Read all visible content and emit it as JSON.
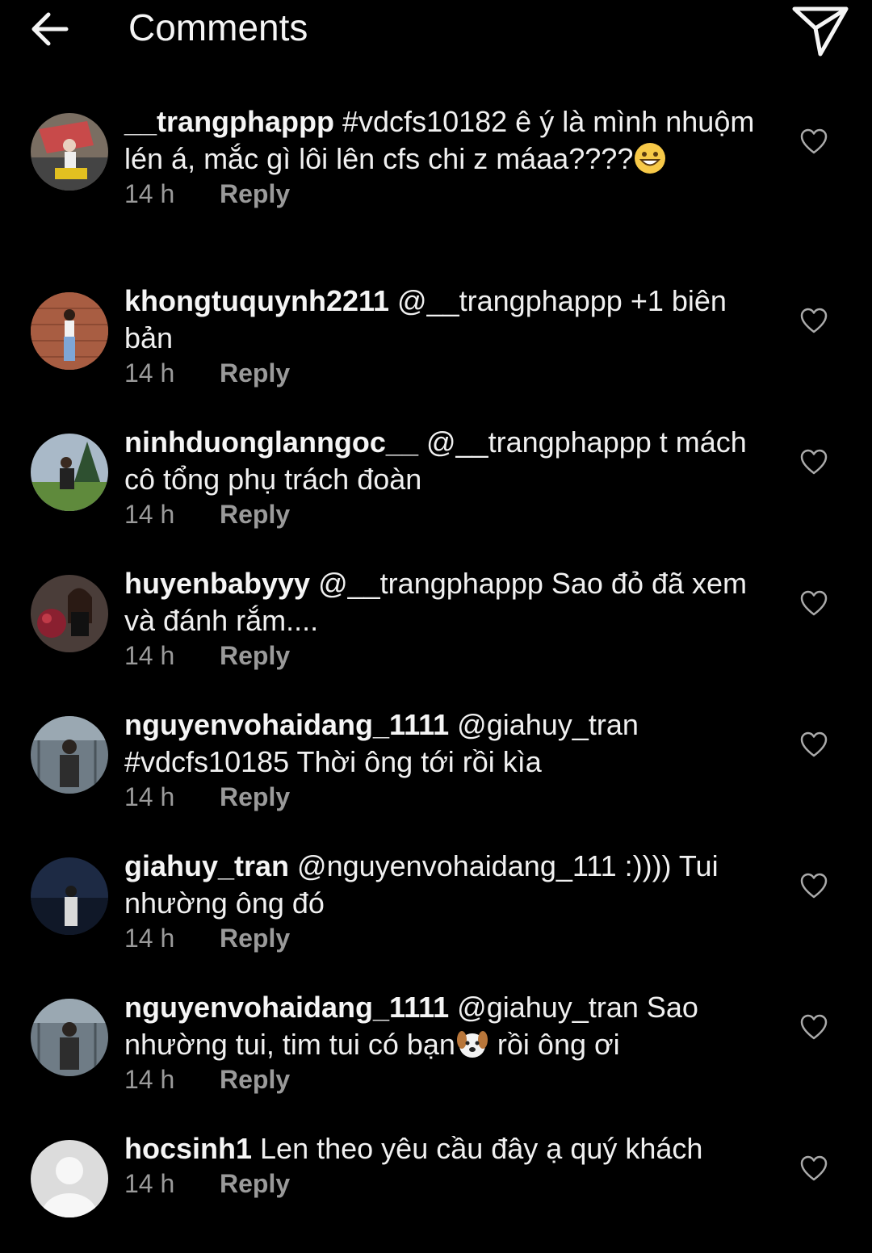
{
  "header": {
    "title": "Comments"
  },
  "comments": [
    {
      "username": "__trangphappp",
      "text": " #vdcfs10182 ê ý là mình nhuộm lén á, mắc gì lôi lên cfs chi z máaa????",
      "emoji": "grinning-face",
      "time": "14 h",
      "reply": "Reply"
    },
    {
      "username": "khongtuquynh2211",
      "text": " @__trangphappp +1 biên bản",
      "time": "14 h",
      "reply": "Reply"
    },
    {
      "username": "ninhduonglanngoc__",
      "text": " @__trangphappp t mách cô tổng phụ trách đoàn",
      "time": "14 h",
      "reply": "Reply"
    },
    {
      "username": "huyenbabyyy",
      "text": " @__trangphappp Sao đỏ đã xem và đánh rắm....",
      "time": "14 h",
      "reply": "Reply"
    },
    {
      "username": "nguyenvohaidang_1111",
      "text": " @giahuy_tran #vdcfs10185 Thời ông tới rồi kìa",
      "time": "14 h",
      "reply": "Reply"
    },
    {
      "username": "giahuy_tran",
      "text": " @nguyenvohaidang_111 :)))) Tui nhường ông đó",
      "time": "14 h",
      "reply": "Reply"
    },
    {
      "username": "nguyenvohaidang_1111",
      "text": " @giahuy_tran Sao nhường tui, tim tui có bạn",
      "emoji_mid": "dog-face",
      "text_after": " rồi ông ơi",
      "time": "14 h",
      "reply": "Reply"
    },
    {
      "username": "hocsinh1",
      "text": " Len theo yêu cầu đây ạ quý khách",
      "time": "14 h",
      "reply": "Reply"
    }
  ],
  "colors": {
    "background": "#000000",
    "text": "#f0f0f0",
    "meta": "#9a9a9a"
  }
}
